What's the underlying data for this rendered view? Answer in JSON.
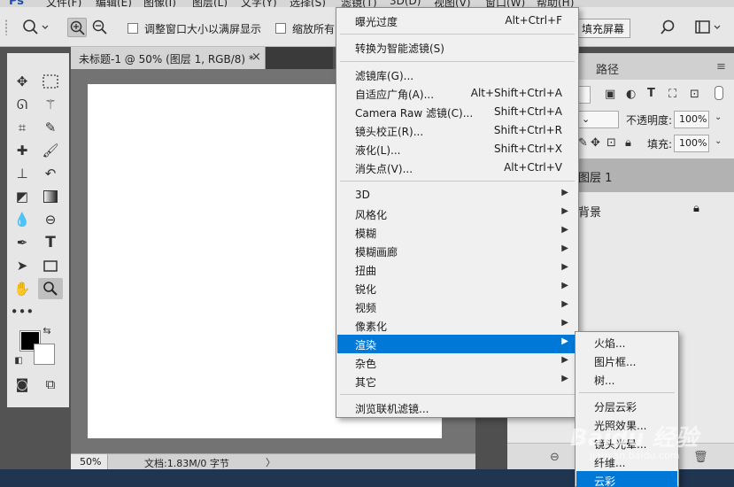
{
  "menubar": {
    "logo": "Ps",
    "items": [
      "文件(F)",
      "编辑(E)",
      "图像(I)",
      "图层(L)",
      "文字(Y)",
      "选择(S)",
      "滤镜(T)",
      "3D(D)",
      "视图(V)",
      "窗口(W)",
      "帮助(H)"
    ]
  },
  "options": {
    "resize_label": "调整窗口大小以满屏显示",
    "zoom_all_label": "缩放所有",
    "fill_screen_label": "填充屏幕"
  },
  "document": {
    "tab_title": "未标题-1 @ 50% (图层 1, RGB/8) *",
    "close": "×"
  },
  "status": {
    "zoom": "50%",
    "doc_info": "文档:1.83M/0 字节",
    "arrow": "〉"
  },
  "layers_panel": {
    "paths_tab": "路径",
    "opacity_label": "不透明度:",
    "opacity_value": "100%",
    "fill_label": "填充:",
    "fill_value": "100%",
    "layers": [
      {
        "name": "图层 1",
        "selected": true
      },
      {
        "name": "背景",
        "locked": true
      }
    ]
  },
  "filter_menu": {
    "items": [
      {
        "label": "曝光过度",
        "shortcut": "Alt+Ctrl+F"
      },
      {
        "label": "转换为智能滤镜(S)",
        "shortcut": ""
      },
      {
        "label": "滤镜库(G)...",
        "shortcut": ""
      },
      {
        "label": "自适应广角(A)...",
        "shortcut": "Alt+Shift+Ctrl+A"
      },
      {
        "label": "Camera Raw 滤镜(C)...",
        "shortcut": "Shift+Ctrl+A"
      },
      {
        "label": "镜头校正(R)...",
        "shortcut": "Shift+Ctrl+R"
      },
      {
        "label": "液化(L)...",
        "shortcut": "Shift+Ctrl+X"
      },
      {
        "label": "消失点(V)...",
        "shortcut": "Alt+Ctrl+V"
      },
      {
        "label": "3D",
        "submenu": true
      },
      {
        "label": "风格化",
        "submenu": true
      },
      {
        "label": "模糊",
        "submenu": true
      },
      {
        "label": "模糊画廊",
        "submenu": true
      },
      {
        "label": "扭曲",
        "submenu": true
      },
      {
        "label": "锐化",
        "submenu": true
      },
      {
        "label": "视频",
        "submenu": true
      },
      {
        "label": "像素化",
        "submenu": true
      },
      {
        "label": "渲染",
        "submenu": true,
        "highlighted": true
      },
      {
        "label": "杂色",
        "submenu": true
      },
      {
        "label": "其它",
        "submenu": true
      },
      {
        "label": "浏览联机滤镜...",
        "shortcut": ""
      }
    ]
  },
  "render_submenu": {
    "items": [
      {
        "label": "火焰..."
      },
      {
        "label": "图片框..."
      },
      {
        "label": "树..."
      },
      {
        "label": "分层云彩"
      },
      {
        "label": "光照效果..."
      },
      {
        "label": "镜头光晕..."
      },
      {
        "label": "纤维..."
      },
      {
        "label": "云彩",
        "highlighted": true
      }
    ]
  },
  "watermark": {
    "line1": "Baidu 经验",
    "line2": "jingyan.baidu.com"
  },
  "colors": {
    "accent": "#0078d7",
    "foreground_swatch": "#000000",
    "background_swatch": "#ffffff"
  }
}
